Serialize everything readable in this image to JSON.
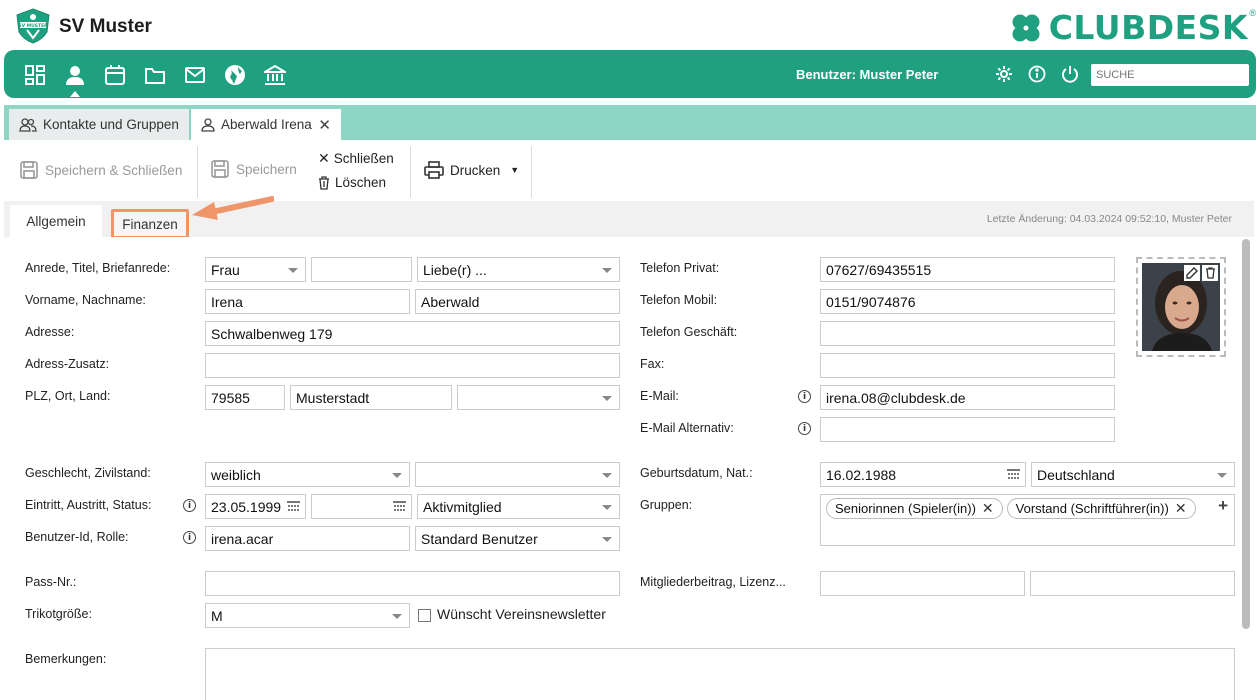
{
  "header": {
    "club_name": "SV Muster",
    "club_logo_text": "SV MUSTER",
    "brand": "CLUBDESK",
    "brand_reg": "®"
  },
  "nav": {
    "icons": [
      "dashboard-icon",
      "user-icon",
      "calendar-icon",
      "folder-icon",
      "mail-icon",
      "globe-icon",
      "bank-icon"
    ],
    "user_label": "Benutzer: Muster Peter",
    "search_placeholder": "SUCHE"
  },
  "tabs": [
    {
      "label": "Kontakte und Gruppen"
    },
    {
      "label": "Aberwald Irena"
    }
  ],
  "toolbar": {
    "save_close": "Speichern & Schließen",
    "save": "Speichern",
    "close": "Schließen",
    "delete": "Löschen",
    "print": "Drucken"
  },
  "subtabs": {
    "general": "Allgemein",
    "finance": "Finanzen",
    "last_change": "Letzte Änderung: 04.03.2024 09:52:10, Muster Peter"
  },
  "form": {
    "labels": {
      "salutation": "Anrede, Titel, Briefanrede:",
      "name": "Vorname, Nachname:",
      "address": "Adresse:",
      "address_extra": "Adress-Zusatz:",
      "zip_city": "PLZ, Ort, Land:",
      "gender": "Geschlecht, Zivilstand:",
      "entry": "Eintritt, Austritt, Status:",
      "user_id": "Benutzer-Id, Rolle:",
      "pass": "Pass-Nr.:",
      "jersey": "Trikotgröße:",
      "remarks": "Bemerkungen:",
      "phone_private": "Telefon Privat:",
      "phone_mobile": "Telefon Mobil:",
      "phone_business": "Telefon Geschäft:",
      "fax": "Fax:",
      "email": "E-Mail:",
      "email_alt": "E-Mail Alternativ:",
      "birthdate": "Geburtsdatum, Nat.:",
      "groups": "Gruppen:",
      "fee": "Mitgliederbeitrag, Lizenz..."
    },
    "values": {
      "salutation": "Frau",
      "title": "",
      "letter_salutation": "Liebe(r) ...",
      "first_name": "Irena",
      "last_name": "Aberwald",
      "address": "Schwalbenweg 179",
      "address_extra": "",
      "zip": "79585",
      "city": "Musterstadt",
      "country": "",
      "gender": "weiblich",
      "civil_status": "",
      "entry_date": "23.05.1999",
      "exit_date": "",
      "status": "Aktivmitglied",
      "user_id": "irena.acar",
      "role": "Standard Benutzer",
      "pass": "",
      "jersey": "M",
      "newsletter": "Wünscht Vereinsnewsletter",
      "phone_private": "07627/69435515",
      "phone_mobile": "0151/9074876",
      "phone_business": "",
      "fax": "",
      "email": "irena.08@clubdesk.de",
      "email_alt": "",
      "birthdate": "16.02.1988",
      "nationality": "Deutschland",
      "groups": [
        "Seniorinnen (Spieler(in))",
        "Vorstand (Schriftführer(in))"
      ]
    }
  },
  "colors": {
    "brand_green": "#1fa080",
    "tab_strip": "#8dd5c4",
    "highlight": "#f0956a"
  }
}
